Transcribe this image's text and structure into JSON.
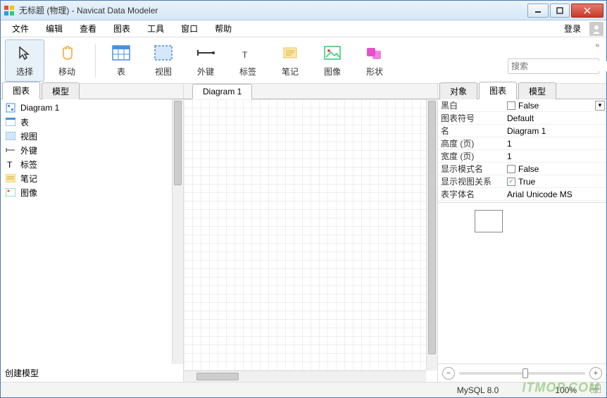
{
  "titlebar": {
    "title": "无标题 (物理) - Navicat Data Modeler"
  },
  "menubar": {
    "items": [
      "文件",
      "编辑",
      "查看",
      "图表",
      "工具",
      "窗口",
      "帮助"
    ],
    "login": "登录"
  },
  "toolbar": {
    "select": "选择",
    "move": "移动",
    "table": "表",
    "view": "视图",
    "foreignkey": "外键",
    "label": "标签",
    "note": "笔记",
    "image": "图像",
    "shape": "形状"
  },
  "search": {
    "placeholder": "搜索"
  },
  "left_tabs": {
    "diagram": "图表",
    "model": "模型"
  },
  "tree": {
    "items": [
      {
        "label": "Diagram 1",
        "icon": "diagram"
      },
      {
        "label": "表",
        "icon": "table"
      },
      {
        "label": "视图",
        "icon": "view"
      },
      {
        "label": "外键",
        "icon": "fk"
      },
      {
        "label": "标签",
        "icon": "label"
      },
      {
        "label": "笔记",
        "icon": "note"
      },
      {
        "label": "图像",
        "icon": "image"
      }
    ],
    "create_model": "创建模型"
  },
  "center_tab": "Diagram 1",
  "right_tabs": {
    "object": "对象",
    "diagram": "图表",
    "model": "模型"
  },
  "props": [
    {
      "label": "黑白",
      "value": "False",
      "type": "check-dd",
      "checked": false
    },
    {
      "label": "图表符号",
      "value": "Default",
      "type": "text"
    },
    {
      "label": "名",
      "value": "Diagram 1",
      "type": "text"
    },
    {
      "label": "高度 (页)",
      "value": "1",
      "type": "text"
    },
    {
      "label": "宽度 (页)",
      "value": "1",
      "type": "text"
    },
    {
      "label": "显示模式名",
      "value": "False",
      "type": "check",
      "checked": false
    },
    {
      "label": "显示视图关系",
      "value": "True",
      "type": "check",
      "checked": true
    },
    {
      "label": "表字体名",
      "value": "Arial Unicode MS",
      "type": "text"
    }
  ],
  "statusbar": {
    "db": "MySQL 8.0",
    "zoom": "100%"
  },
  "watermark": "ITMOP.COM"
}
